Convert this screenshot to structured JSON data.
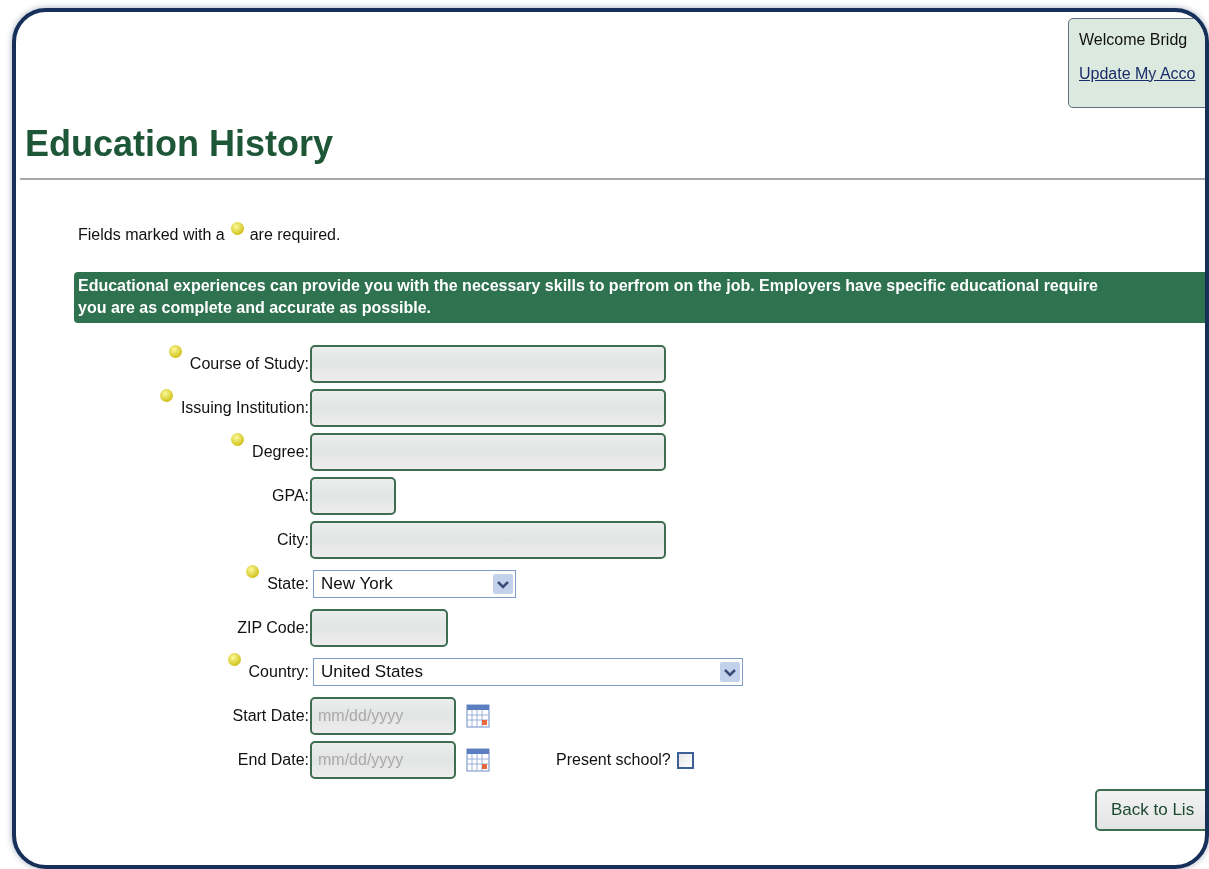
{
  "account": {
    "welcome": "Welcome Bridg",
    "link": "Update My Acco"
  },
  "title": "Education History",
  "required_note": {
    "before": "Fields marked with a",
    "after": "are required."
  },
  "banner": [
    "Educational experiences can provide you with the necessary skills to perfrom on the job. Employers have specific educational require",
    "you are as complete and accurate as possible."
  ],
  "fields": [
    {
      "label": "Course of Study:",
      "required": true,
      "kind": "text"
    },
    {
      "label": "Issuing Institution:",
      "required": true,
      "kind": "text"
    },
    {
      "label": "Degree:",
      "required": true,
      "kind": "text"
    },
    {
      "label": "GPA:",
      "required": false,
      "kind": "text"
    },
    {
      "label": "City:",
      "required": false,
      "kind": "text"
    },
    {
      "label": "State:",
      "required": true,
      "kind": "select",
      "value": "New York"
    },
    {
      "label": "ZIP Code:",
      "required": false,
      "kind": "text"
    },
    {
      "label": "Country:",
      "required": true,
      "kind": "select",
      "value": "United States"
    },
    {
      "label": "Start Date:",
      "required": false,
      "kind": "date",
      "placeholder": "mm/dd/yyyy"
    },
    {
      "label": "End Date:",
      "required": false,
      "kind": "date",
      "placeholder": "mm/dd/yyyy",
      "extra": {
        "label": "Present school?",
        "checked": false
      }
    }
  ],
  "back_button": "Back to Lis"
}
